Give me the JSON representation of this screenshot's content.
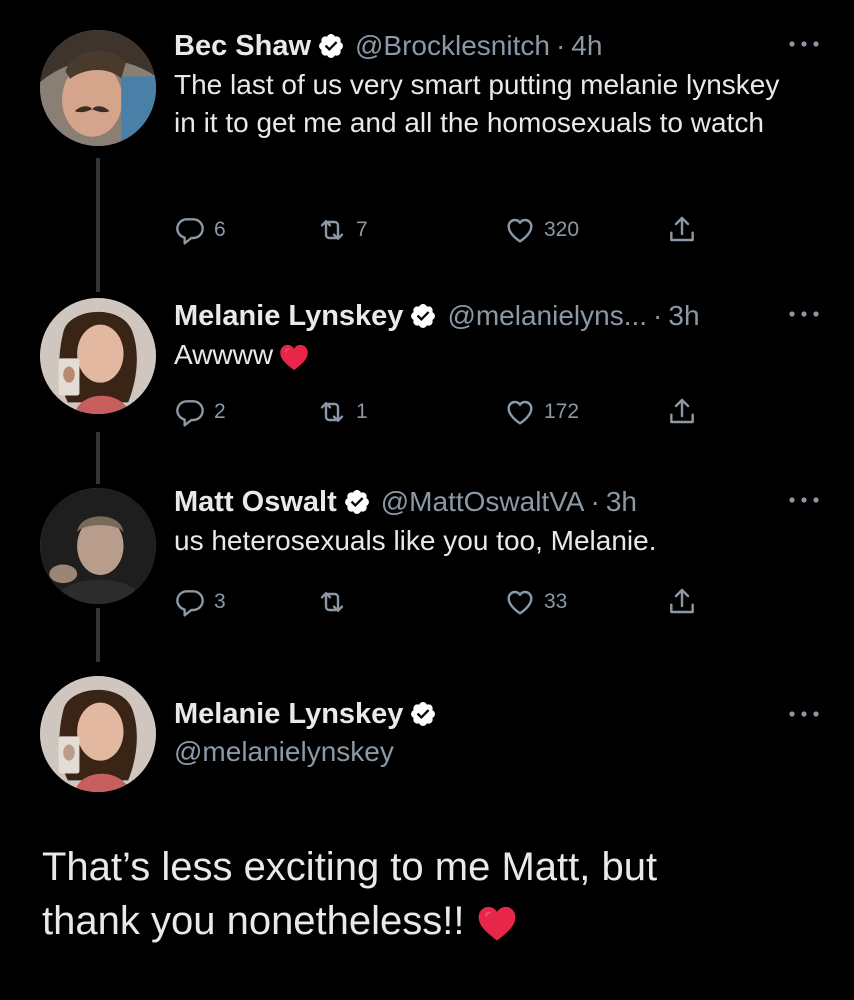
{
  "colors": {
    "background": "#000000",
    "text": "#e7e9ea",
    "muted": "#8b98a5",
    "verified": "#ffffff",
    "heart": "#e8264a",
    "thread_line": "#333639"
  },
  "tweets": [
    {
      "display_name": "Bec Shaw",
      "handle": "@Brocklesnitch",
      "separator": "·",
      "time": "4h",
      "text": "The last of us very smart putting melanie lynskey in it to get me and all the homosexuals to watch",
      "replies": "6",
      "retweets": "7",
      "likes": "320",
      "icons": [
        "reply-icon",
        "retweet-icon",
        "like-icon",
        "share-icon",
        "more-icon",
        "verified-badge-icon"
      ]
    },
    {
      "display_name": "Melanie Lynskey",
      "handle": "@melanielyns...",
      "separator": "·",
      "time": "3h",
      "text": "Awwww",
      "emoji": "red-heart",
      "replies": "2",
      "retweets": "1",
      "likes": "172"
    },
    {
      "display_name": "Matt Oswalt",
      "handle": "@MattOswaltVA",
      "separator": "·",
      "time": "3h",
      "text": "us heterosexuals like you too, Melanie.",
      "replies": "3",
      "retweets": "",
      "likes": "33"
    }
  ],
  "focus_tweet": {
    "display_name": "Melanie Lynskey",
    "handle": "@melanielynskey",
    "text_line1": "That’s less exciting to me Matt, but",
    "text_line2": "thank you nonetheless!!",
    "emoji": "red-heart"
  }
}
